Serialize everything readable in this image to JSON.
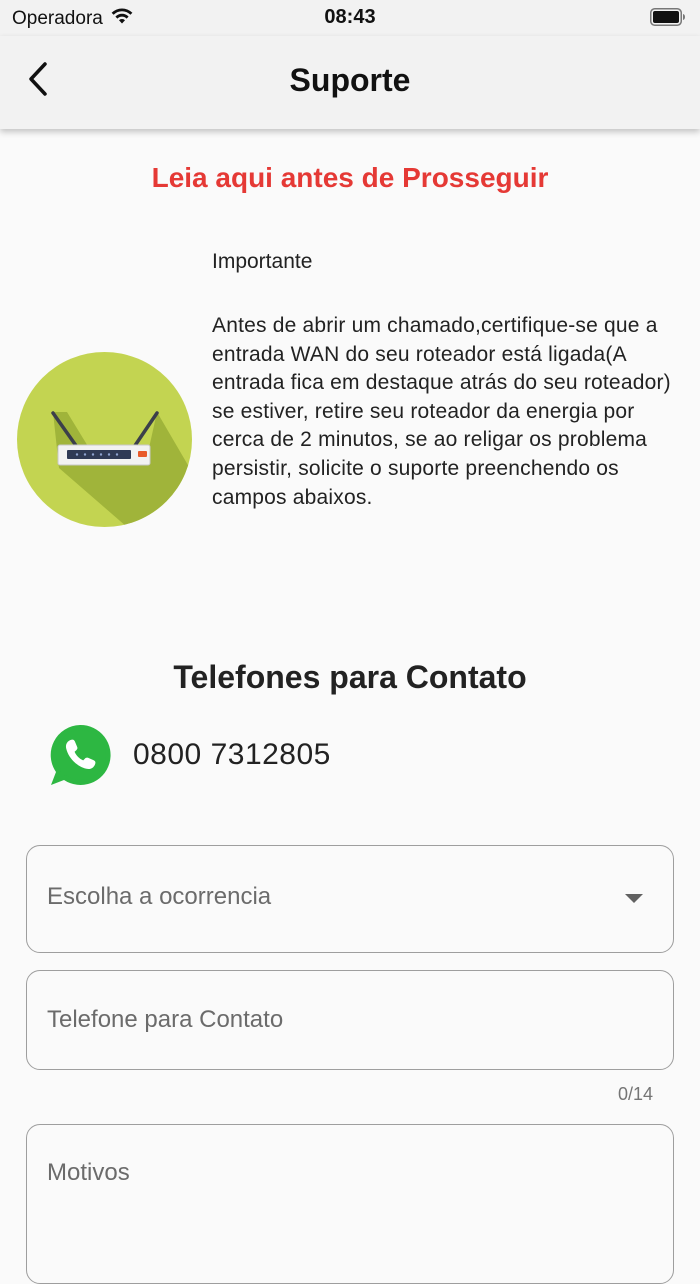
{
  "status_bar": {
    "carrier": "Operadora",
    "time": "08:43"
  },
  "app_bar": {
    "title": "Suporte",
    "back_icon": "chevron-left-icon"
  },
  "notice": {
    "heading": "Leia aqui antes de Prosseguir",
    "label": "Importante",
    "body": "Antes de abrir um chamado,certifique-se que a entrada WAN do seu roteador está ligada(A entrada fica em destaque atrás do seu roteador) se estiver, retire seu roteador da energia por cerca de 2 minutos, se ao religar os problema persistir, solicite o suporte preenchendo os campos abaixos.",
    "illustration_icon": "router-icon"
  },
  "contacts": {
    "heading": "Telefones para Contato",
    "whatsapp_icon": "whatsapp-icon",
    "phone": "0800 7312805"
  },
  "form": {
    "occurrence_label": "Escolha a ocorrencia",
    "phone_label": "Telefone para Contato",
    "phone_counter": "0/14",
    "reason_label": "Motivos"
  },
  "colors": {
    "accent_red": "#e53935",
    "illustration_green": "#c3d451",
    "whatsapp_green": "#2db742"
  }
}
